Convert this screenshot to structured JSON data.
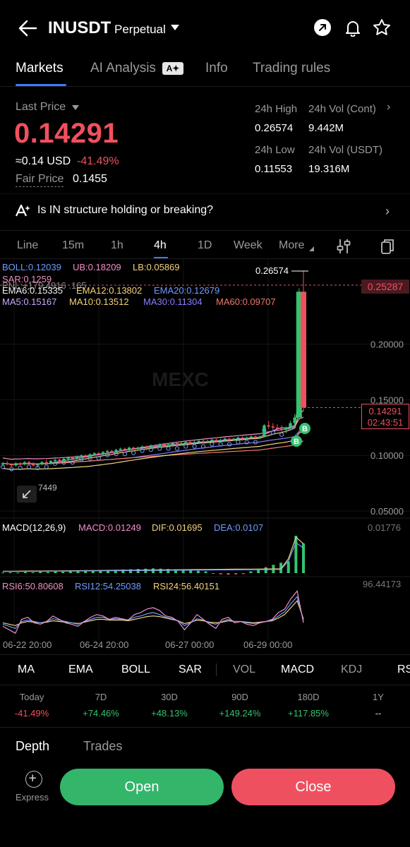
{
  "header": {
    "symbol": "INUSDT",
    "contract_type": "Perpetual",
    "icons": [
      "back-arrow-icon",
      "share-icon",
      "bell-icon",
      "star-icon"
    ]
  },
  "tabs": [
    {
      "label": "Markets",
      "active": true
    },
    {
      "label": "AI Analysis",
      "active": false
    },
    {
      "label": "Info",
      "active": false
    },
    {
      "label": "Trading rules",
      "active": false
    }
  ],
  "price": {
    "last_price_label": "Last Price",
    "last_price": "0.14291",
    "usd_value": "≈0.14 USD",
    "change_pct": "-41.49%",
    "fair_price_label": "Fair Price",
    "fair_price": "0.1455"
  },
  "stats": {
    "high_label": "24h High",
    "high": "0.26574",
    "vol_cont_label": "24h Vol (Cont)",
    "vol_cont": "9.442M",
    "low_label": "24h Low",
    "low": "0.11553",
    "vol_usdt_label": "24h Vol  (USDT)",
    "vol_usdt": "19.316M"
  },
  "ai_prompt": "Is IN structure holding or breaking?",
  "intervals": [
    {
      "label": "Line",
      "active": false
    },
    {
      "label": "15m",
      "active": false
    },
    {
      "label": "1h",
      "active": false
    },
    {
      "label": "4h",
      "active": true
    },
    {
      "label": "1D",
      "active": false
    },
    {
      "label": "Week",
      "active": false
    },
    {
      "label": "More",
      "active": false
    }
  ],
  "indicators": {
    "boll": "BOLL:0.12039",
    "ub": "UB:0.18209",
    "lb": "LB:0.05869",
    "sar": "SAR:0.1259",
    "pnl": "PNL:+179.4916 .165",
    "ema6": "EMA6:0.15335",
    "ema12": "EMA12:0.13802",
    "ema20": "EMA20:0.12679",
    "ma5": "MA5:0.15167",
    "ma10": "MA10:0.13512",
    "ma30": "MA30:0.11304",
    "ma60": "MA60:0.09707",
    "macd_title": "MACD(12,26,9)",
    "macd": "MACD:0.01249",
    "dif": "DIF:0.01695",
    "dea": "DEA:0.0107",
    "macd_max": "0.01776",
    "rsi6": "RSI6:50.80608",
    "rsi12": "RSI12:54.25038",
    "rsi24": "RSI24:56.40151",
    "rsi_max": "96.44173"
  },
  "chart_data": {
    "type": "candlestick",
    "symbol": "INUSDT",
    "interval": "4h",
    "y_axis_ticks": [
      "0.20000",
      "0.15000",
      "0.10000",
      "0.05000"
    ],
    "ylim": [
      0.045,
      0.27
    ],
    "x_axis_ticks": [
      "06-22 20:00",
      "06-24 20:00",
      "06-27 00:00",
      "06-29 00:00"
    ],
    "high_marker": "0.26574",
    "cursor_price": "0.25287",
    "current_price": "0.14291",
    "countdown": "02:43:51",
    "watermark": "MEXC",
    "partial_label": "7449",
    "candles": [
      [
        0.092,
        0.094,
        0.09,
        0.093
      ],
      [
        0.093,
        0.095,
        0.091,
        0.092
      ],
      [
        0.092,
        0.093,
        0.089,
        0.091
      ],
      [
        0.091,
        0.094,
        0.09,
        0.093
      ],
      [
        0.093,
        0.094,
        0.091,
        0.092
      ],
      [
        0.092,
        0.095,
        0.091,
        0.094
      ],
      [
        0.094,
        0.095,
        0.092,
        0.093
      ],
      [
        0.093,
        0.094,
        0.09,
        0.091
      ],
      [
        0.091,
        0.093,
        0.089,
        0.092
      ],
      [
        0.092,
        0.095,
        0.091,
        0.094
      ],
      [
        0.094,
        0.096,
        0.092,
        0.093
      ],
      [
        0.093,
        0.096,
        0.092,
        0.095
      ],
      [
        0.095,
        0.097,
        0.093,
        0.096
      ],
      [
        0.096,
        0.097,
        0.094,
        0.095
      ],
      [
        0.095,
        0.098,
        0.094,
        0.097
      ],
      [
        0.097,
        0.099,
        0.095,
        0.098
      ],
      [
        0.098,
        0.099,
        0.096,
        0.097
      ],
      [
        0.097,
        0.1,
        0.096,
        0.099
      ],
      [
        0.099,
        0.101,
        0.097,
        0.1
      ],
      [
        0.1,
        0.101,
        0.098,
        0.099
      ],
      [
        0.099,
        0.102,
        0.098,
        0.101
      ],
      [
        0.101,
        0.103,
        0.1,
        0.102
      ],
      [
        0.102,
        0.103,
        0.1,
        0.101
      ],
      [
        0.101,
        0.104,
        0.1,
        0.103
      ],
      [
        0.103,
        0.105,
        0.101,
        0.104
      ],
      [
        0.104,
        0.105,
        0.102,
        0.103
      ],
      [
        0.103,
        0.106,
        0.102,
        0.105
      ],
      [
        0.105,
        0.107,
        0.104,
        0.106
      ],
      [
        0.106,
        0.107,
        0.104,
        0.105
      ],
      [
        0.105,
        0.108,
        0.104,
        0.107
      ],
      [
        0.107,
        0.108,
        0.105,
        0.106
      ],
      [
        0.106,
        0.108,
        0.105,
        0.107
      ],
      [
        0.107,
        0.109,
        0.106,
        0.108
      ],
      [
        0.108,
        0.109,
        0.106,
        0.107
      ],
      [
        0.107,
        0.11,
        0.106,
        0.109
      ],
      [
        0.109,
        0.11,
        0.107,
        0.108
      ],
      [
        0.108,
        0.111,
        0.107,
        0.11
      ],
      [
        0.11,
        0.111,
        0.108,
        0.109
      ],
      [
        0.109,
        0.111,
        0.108,
        0.11
      ],
      [
        0.11,
        0.112,
        0.109,
        0.111
      ],
      [
        0.111,
        0.112,
        0.109,
        0.11
      ],
      [
        0.11,
        0.112,
        0.109,
        0.111
      ],
      [
        0.111,
        0.113,
        0.11,
        0.112
      ],
      [
        0.112,
        0.113,
        0.11,
        0.111
      ],
      [
        0.111,
        0.113,
        0.11,
        0.112
      ],
      [
        0.112,
        0.114,
        0.111,
        0.113
      ],
      [
        0.113,
        0.114,
        0.111,
        0.112
      ],
      [
        0.112,
        0.114,
        0.111,
        0.113
      ],
      [
        0.113,
        0.115,
        0.112,
        0.114
      ],
      [
        0.114,
        0.115,
        0.112,
        0.113
      ],
      [
        0.113,
        0.115,
        0.112,
        0.114
      ],
      [
        0.114,
        0.116,
        0.113,
        0.115
      ],
      [
        0.115,
        0.116,
        0.113,
        0.114
      ],
      [
        0.114,
        0.116,
        0.113,
        0.115
      ],
      [
        0.115,
        0.117,
        0.114,
        0.116
      ],
      [
        0.116,
        0.117,
        0.114,
        0.115
      ],
      [
        0.115,
        0.117,
        0.114,
        0.116
      ],
      [
        0.116,
        0.118,
        0.115,
        0.117
      ],
      [
        0.117,
        0.118,
        0.115,
        0.116
      ],
      [
        0.116,
        0.118,
        0.115,
        0.117
      ],
      [
        0.117,
        0.128,
        0.116,
        0.127
      ],
      [
        0.127,
        0.131,
        0.124,
        0.126
      ],
      [
        0.126,
        0.129,
        0.123,
        0.125
      ],
      [
        0.125,
        0.128,
        0.122,
        0.124
      ],
      [
        0.124,
        0.127,
        0.121,
        0.123
      ],
      [
        0.123,
        0.126,
        0.12,
        0.125
      ],
      [
        0.125,
        0.131,
        0.123,
        0.129
      ],
      [
        0.129,
        0.137,
        0.126,
        0.134
      ],
      [
        0.134,
        0.25,
        0.132,
        0.247
      ],
      [
        0.247,
        0.26574,
        0.14,
        0.14291
      ]
    ],
    "macd_histogram": [
      0.0002,
      0.0003,
      0.0002,
      0.0004,
      0.0003,
      0.0005,
      0.0004,
      0.0006,
      0.0005,
      0.0007,
      0.0006,
      0.0008,
      0.0007,
      0.0009,
      0.001,
      0.0011,
      0.0012,
      0.0013,
      0.0014,
      0.0015,
      0.0016,
      0.0015,
      0.0014,
      0.0013,
      0.0012,
      0.001,
      0.0008,
      0.0006,
      -0.0002,
      -0.0004,
      -0.0005,
      -0.0004,
      -0.0003,
      0.0006,
      0.0012,
      0.002,
      0.0028,
      0.0035,
      0.004,
      0.0126,
      0.01
    ],
    "rsi6": [
      45,
      40,
      35,
      55,
      58,
      50,
      48,
      52,
      60,
      55,
      50,
      48,
      45,
      52,
      58,
      62,
      60,
      55,
      58,
      56,
      54,
      62,
      65,
      70,
      72,
      68,
      60,
      58,
      52,
      40,
      50,
      62,
      55,
      48,
      42,
      55,
      58,
      50,
      52,
      48,
      46,
      50,
      52,
      55,
      65,
      70,
      85,
      96,
      50
    ],
    "rsi12": [
      48,
      45,
      42,
      52,
      54,
      52,
      50,
      52,
      56,
      54,
      52,
      50,
      48,
      52,
      55,
      58,
      58,
      55,
      56,
      55,
      54,
      58,
      60,
      63,
      65,
      62,
      58,
      56,
      53,
      46,
      50,
      56,
      54,
      50,
      48,
      52,
      55,
      52,
      52,
      50,
      49,
      50,
      52,
      54,
      60,
      66,
      78,
      88,
      54
    ],
    "rsi24": [
      50,
      48,
      46,
      50,
      52,
      51,
      50,
      51,
      53,
      52,
      51,
      50,
      49,
      51,
      53,
      55,
      55,
      54,
      54,
      54,
      53,
      55,
      57,
      59,
      60,
      59,
      57,
      55,
      53,
      49,
      51,
      54,
      53,
      51,
      50,
      51,
      53,
      52,
      52,
      51,
      50,
      51,
      52,
      53,
      57,
      62,
      72,
      82,
      56
    ]
  },
  "indicator_buttons": [
    {
      "label": "MA",
      "dim": false
    },
    {
      "label": "EMA",
      "dim": false
    },
    {
      "label": "BOLL",
      "dim": false
    },
    {
      "label": "SAR",
      "dim": false
    },
    {
      "label": "VOL",
      "dim": true
    },
    {
      "label": "MACD",
      "dim": false
    },
    {
      "label": "KDJ",
      "dim": true
    },
    {
      "label": "RS",
      "dim": false
    }
  ],
  "performance": [
    {
      "label": "Today",
      "value": "-41.49%",
      "color": "red"
    },
    {
      "label": "7D",
      "value": "+74.46%",
      "color": "green"
    },
    {
      "label": "30D",
      "value": "+48.13%",
      "color": "green"
    },
    {
      "label": "90D",
      "value": "+149.24%",
      "color": "green"
    },
    {
      "label": "180D",
      "value": "+117.85%",
      "color": "green"
    },
    {
      "label": "1Y",
      "value": "--",
      "color": "white"
    }
  ],
  "bottom": {
    "depth_tab": "Depth",
    "trades_tab": "Trades",
    "express_label": "Express",
    "open_label": "Open",
    "close_label": "Close"
  },
  "colors": {
    "up": "#33c36f",
    "down": "#f0505e",
    "accent": "#3d7bff",
    "background": "#000000"
  }
}
